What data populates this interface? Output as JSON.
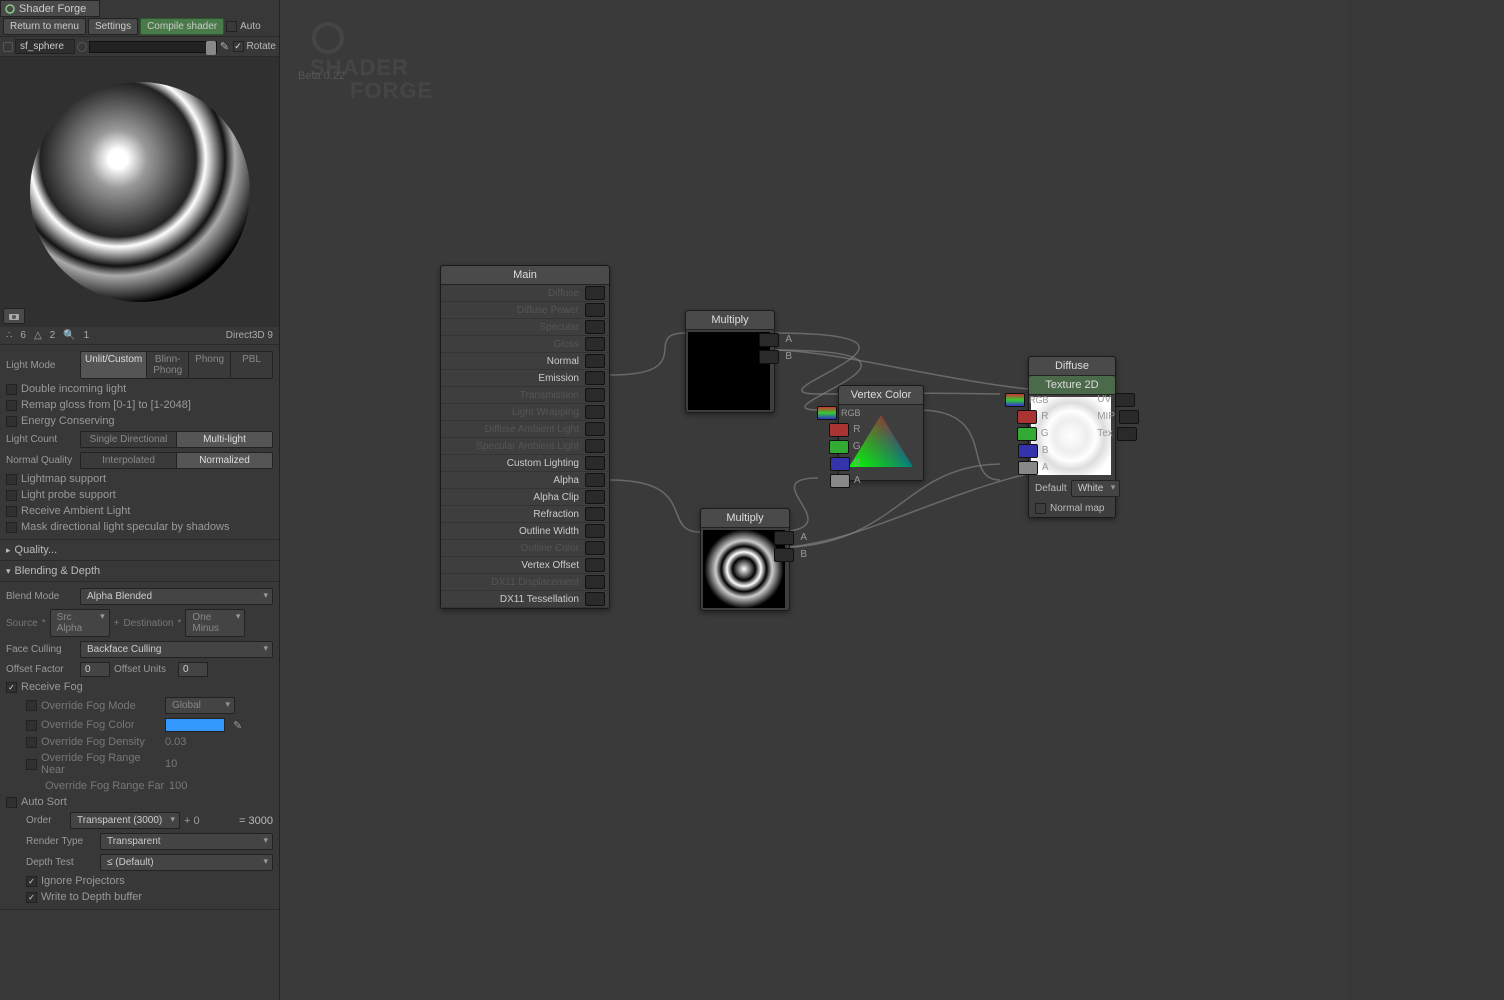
{
  "app": {
    "title": "Shader Forge",
    "version": "Beta 0.22",
    "logo": "SHADER FORGE",
    "renderer": "Direct3D 9"
  },
  "toolbar": {
    "return": "Return to menu",
    "settings": "Settings",
    "compile": "Compile shader",
    "auto": "Auto",
    "mesh": "sf_sphere",
    "rotate": "Rotate"
  },
  "stats": {
    "verts": "6",
    "tris": "2",
    "draws": "1"
  },
  "lighting": {
    "mode_label": "Light Mode",
    "modes": [
      "Unlit/Custom",
      "Blinn-Phong",
      "Phong",
      "PBL"
    ],
    "mode_active": 0,
    "double_incoming": "Double incoming light",
    "remap_gloss": "Remap gloss from [0-1] to [1-2048]",
    "energy_conserving": "Energy Conserving",
    "light_count_label": "Light Count",
    "light_count_opts": [
      "Single Directional",
      "Multi-light"
    ],
    "light_count_active": 1,
    "normal_quality_label": "Normal Quality",
    "normal_quality_opts": [
      "Interpolated",
      "Normalized"
    ],
    "normal_quality_active": 1,
    "lightmap": "Lightmap support",
    "lightprobe": "Light probe support",
    "recv_ambient": "Receive Ambient Light",
    "mask_dir": "Mask directional light specular by shadows"
  },
  "quality_header": "Quality...",
  "blending": {
    "header": "Blending & Depth",
    "blend_mode_label": "Blend Mode",
    "blend_mode": "Alpha Blended",
    "source_label": "Source",
    "source": "Src Alpha",
    "dest_label": "Destination",
    "dest": "One Minus",
    "face_culling_label": "Face Culling",
    "face_culling": "Backface Culling",
    "offset_factor_label": "Offset Factor",
    "offset_factor": "0",
    "offset_units_label": "Offset Units",
    "offset_units": "0",
    "receive_fog": "Receive Fog",
    "override_mode": "Override Fog Mode",
    "override_mode_val": "Global",
    "override_color": "Override Fog Color",
    "override_color_val": "#3399ff",
    "override_density": "Override Fog Density",
    "override_density_val": "0.03",
    "override_near": "Override Fog Range Near",
    "override_near_val": "10",
    "override_far": "Override Fog Range Far",
    "override_far_val": "100",
    "auto_sort": "Auto Sort",
    "order_label": "Order",
    "order": "Transparent (3000)",
    "order_plus": "+ 0",
    "order_eq": "= 3000",
    "render_type_label": "Render Type",
    "render_type": "Transparent",
    "depth_test_label": "Depth Test",
    "depth_test": "≤ (Default)",
    "ignore_proj": "Ignore Projectors",
    "write_depth": "Write to Depth buffer"
  },
  "nodes": {
    "main": {
      "title": "Main",
      "outputs": [
        "Diffuse",
        "Diffuse Power",
        "Specular",
        "Gloss",
        "Normal",
        "Emission",
        "Transmission",
        "Light Wrapping",
        "Diffuse Ambient Light",
        "Specular Ambient Light",
        "Custom Lighting",
        "Alpha",
        "Alpha Clip",
        "Refraction",
        "Outline Width",
        "Outline Color",
        "Vertex Offset",
        "DX11 Displacement",
        "DX11 Tessellation"
      ],
      "lit": [
        4,
        5,
        10,
        11,
        12,
        13,
        14,
        16,
        18
      ]
    },
    "multiply1": {
      "title": "Multiply",
      "inputs": [
        "A",
        "B"
      ]
    },
    "multiply2": {
      "title": "Multiply",
      "inputs": [
        "A",
        "B"
      ]
    },
    "vertex_color": {
      "title": "Vertex Color",
      "outputs": [
        "RGB",
        "R",
        "G",
        "B",
        "A"
      ]
    },
    "diffuse": {
      "title": "Diffuse",
      "subtitle": "Texture 2D",
      "outputs": [
        "RGB",
        "R",
        "G",
        "B",
        "A"
      ],
      "inputs": [
        "UV",
        "MIP",
        "Tex"
      ],
      "default_label": "Default",
      "default_val": "White",
      "normal_map": "Normal map"
    }
  }
}
